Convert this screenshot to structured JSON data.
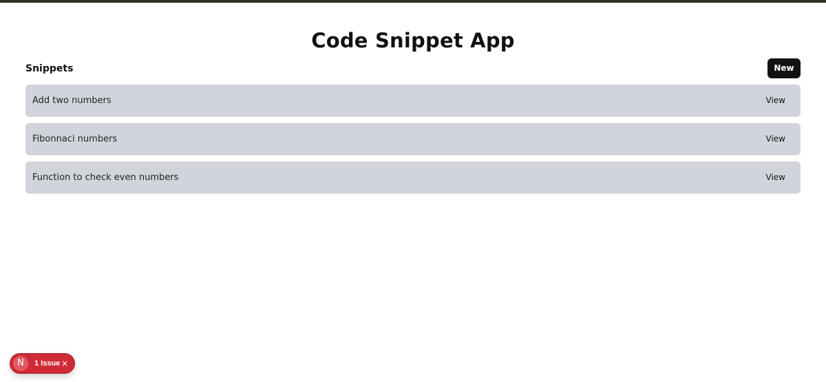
{
  "app": {
    "title": "Code Snippet App"
  },
  "header": {
    "section_title": "Snippets",
    "new_button_label": "New"
  },
  "snippets": [
    {
      "title": "Add two numbers",
      "action_label": "View"
    },
    {
      "title": "Fibonnaci numbers",
      "action_label": "View"
    },
    {
      "title": "Function to check even numbers",
      "action_label": "View"
    }
  ],
  "dev_overlay": {
    "logo_letter": "N",
    "issue_label": "1 Issue",
    "close_glyph": "×"
  },
  "colors": {
    "top_border": "#2c3624",
    "new_button_bg": "#121212",
    "snippet_bg": "#d1d5db",
    "issue_badge_bg": "#cf2b36"
  },
  "icons": {
    "logo": "nextjs-logo-icon",
    "close": "close-icon"
  }
}
